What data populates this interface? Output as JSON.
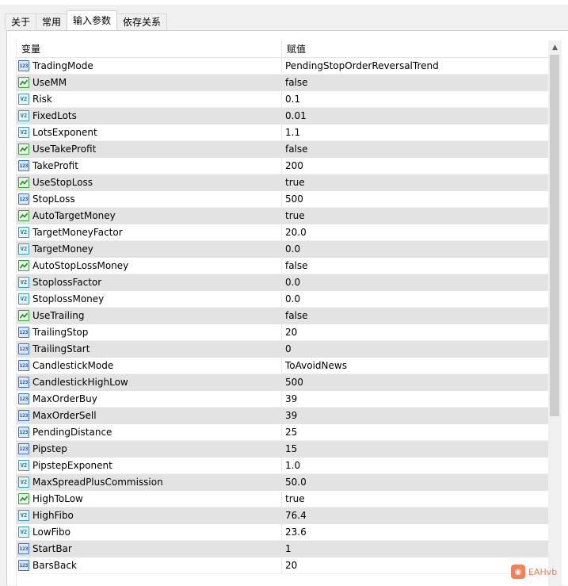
{
  "tabs": [
    {
      "label": "关于",
      "active": false
    },
    {
      "label": "常用",
      "active": false
    },
    {
      "label": "输入参数",
      "active": true
    },
    {
      "label": "依存关系",
      "active": false
    }
  ],
  "grid": {
    "columns": {
      "variable": "变量",
      "value": "赋值"
    },
    "rows": [
      {
        "type": "int",
        "name": "TradingMode",
        "value": "PendingStopOrderReversalTrend"
      },
      {
        "type": "bool",
        "name": "UseMM",
        "value": "false"
      },
      {
        "type": "dbl",
        "name": "Risk",
        "value": "0.1"
      },
      {
        "type": "dbl",
        "name": "FixedLots",
        "value": "0.01"
      },
      {
        "type": "dbl",
        "name": "LotsExponent",
        "value": "1.1"
      },
      {
        "type": "bool",
        "name": "UseTakeProfit",
        "value": "false"
      },
      {
        "type": "int",
        "name": "TakeProfit",
        "value": "200"
      },
      {
        "type": "bool",
        "name": "UseStopLoss",
        "value": "true"
      },
      {
        "type": "int",
        "name": "StopLoss",
        "value": "500"
      },
      {
        "type": "bool",
        "name": "AutoTargetMoney",
        "value": "true"
      },
      {
        "type": "dbl",
        "name": "TargetMoneyFactor",
        "value": "20.0"
      },
      {
        "type": "dbl",
        "name": "TargetMoney",
        "value": "0.0"
      },
      {
        "type": "bool",
        "name": "AutoStopLossMoney",
        "value": "false"
      },
      {
        "type": "dbl",
        "name": "StoplossFactor",
        "value": "0.0"
      },
      {
        "type": "dbl",
        "name": "StoplossMoney",
        "value": "0.0"
      },
      {
        "type": "bool",
        "name": "UseTrailing",
        "value": "false"
      },
      {
        "type": "int",
        "name": "TrailingStop",
        "value": "20"
      },
      {
        "type": "int",
        "name": "TrailingStart",
        "value": "0"
      },
      {
        "type": "int",
        "name": "CandlestickMode",
        "value": "ToAvoidNews"
      },
      {
        "type": "int",
        "name": "CandlestickHighLow",
        "value": "500"
      },
      {
        "type": "int",
        "name": "MaxOrderBuy",
        "value": "39"
      },
      {
        "type": "int",
        "name": "MaxOrderSell",
        "value": "39"
      },
      {
        "type": "int",
        "name": "PendingDistance",
        "value": "25"
      },
      {
        "type": "int",
        "name": "Pipstep",
        "value": "15"
      },
      {
        "type": "dbl",
        "name": "PipstepExponent",
        "value": "1.0"
      },
      {
        "type": "dbl",
        "name": "MaxSpreadPlusCommission",
        "value": "50.0"
      },
      {
        "type": "bool",
        "name": "HighToLow",
        "value": "true"
      },
      {
        "type": "dbl",
        "name": "HighFibo",
        "value": "76.4"
      },
      {
        "type": "dbl",
        "name": "LowFibo",
        "value": "23.6"
      },
      {
        "type": "int",
        "name": "StartBar",
        "value": "1"
      },
      {
        "type": "int",
        "name": "BarsBack",
        "value": "20"
      }
    ]
  },
  "icons": {
    "int": "123",
    "dbl": "V2"
  },
  "watermark": {
    "text": "EAHvb"
  }
}
